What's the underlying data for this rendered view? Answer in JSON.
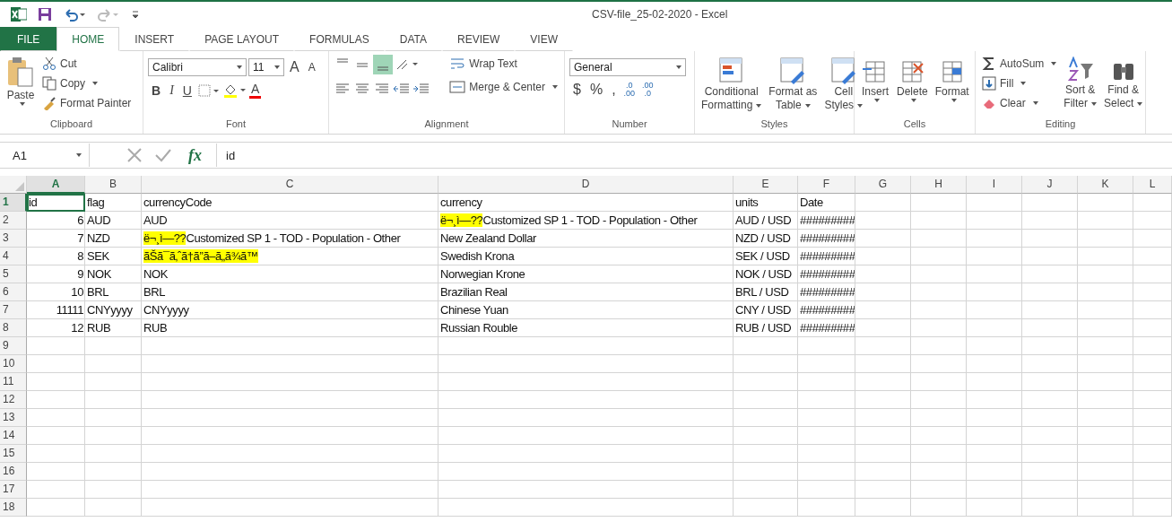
{
  "title": "CSV-file_25-02-2020 - Excel",
  "tabs": [
    {
      "label": "FILE",
      "kind": "file",
      "selected": false
    },
    {
      "label": "HOME",
      "kind": "tab",
      "selected": true
    },
    {
      "label": "INSERT",
      "kind": "tab",
      "selected": false
    },
    {
      "label": "PAGE LAYOUT",
      "kind": "tab",
      "selected": false
    },
    {
      "label": "FORMULAS",
      "kind": "tab",
      "selected": false
    },
    {
      "label": "DATA",
      "kind": "tab",
      "selected": false
    },
    {
      "label": "REVIEW",
      "kind": "tab",
      "selected": false
    },
    {
      "label": "VIEW",
      "kind": "tab",
      "selected": false
    }
  ],
  "ribbon": {
    "clipboard": {
      "label": "Clipboard",
      "paste": "Paste",
      "cut": "Cut",
      "copy": "Copy",
      "format_painter": "Format Painter"
    },
    "font": {
      "label": "Font",
      "font_name": "Calibri",
      "font_size": "11",
      "grow": "A",
      "shrink": "A",
      "bold": "B",
      "italic": "I",
      "underline": "U",
      "font_color": "A"
    },
    "alignment": {
      "label": "Alignment",
      "wrap_text": "Wrap Text",
      "merge_center": "Merge & Center",
      "bottom_align_selected": true
    },
    "number": {
      "label": "Number",
      "format": "General",
      "currency": "$",
      "percent": "%",
      "comma": ",",
      "decimals": [
        {
          "top": ".0",
          "bottom": ".00"
        },
        {
          "top": ".00",
          "bottom": ".0"
        }
      ]
    },
    "styles": {
      "label": "Styles",
      "buttons": [
        {
          "lines": [
            "Conditional",
            "Formatting"
          ]
        },
        {
          "lines": [
            "Format as",
            "Table"
          ]
        },
        {
          "lines": [
            "Cell",
            "Styles"
          ]
        }
      ]
    },
    "cells": {
      "label": "Cells",
      "buttons": [
        "Insert",
        "Delete",
        "Format"
      ]
    },
    "editing": {
      "label": "Editing",
      "autosum": "AutoSum",
      "fill": "Fill",
      "clear": "Clear",
      "buttons": [
        {
          "lines": [
            "Sort &",
            "Filter"
          ]
        },
        {
          "lines": [
            "Find &",
            "Select"
          ]
        }
      ]
    }
  },
  "formula_bar": {
    "name_box": "A1",
    "fx": "fx",
    "value": "id"
  },
  "columns": [
    {
      "label": "A",
      "selected": true
    },
    {
      "label": "B",
      "selected": false
    },
    {
      "label": "C",
      "selected": false
    },
    {
      "label": "D",
      "selected": false
    },
    {
      "label": "E",
      "selected": false
    },
    {
      "label": "F",
      "selected": false
    },
    {
      "label": "G",
      "selected": false
    },
    {
      "label": "H",
      "selected": false
    },
    {
      "label": "I",
      "selected": false
    },
    {
      "label": "J",
      "selected": false
    },
    {
      "label": "K",
      "selected": false
    },
    {
      "label": "L",
      "selected": false
    }
  ],
  "rows": [
    {
      "label": "1",
      "selected": true,
      "cells": [
        {
          "text": "id",
          "kind": "text"
        },
        {
          "text": "flag",
          "kind": "text"
        },
        {
          "text": "currencyCode",
          "kind": "text"
        },
        {
          "text": "currency",
          "kind": "text"
        },
        {
          "text": "units",
          "kind": "text"
        },
        {
          "text": "Date",
          "kind": "text"
        }
      ]
    },
    {
      "label": "2",
      "selected": false,
      "cells": [
        {
          "text": "6",
          "kind": "number"
        },
        {
          "text": "AUD",
          "kind": "text"
        },
        {
          "text": "AUD",
          "kind": "text"
        },
        {
          "highlight": "ë¬¸ì—??",
          "text": "Customized SP 1 - TOD - Population - Other",
          "kind": "text"
        },
        {
          "text": "AUD / USD",
          "kind": "text"
        },
        {
          "text": "#########",
          "kind": "text"
        }
      ]
    },
    {
      "label": "3",
      "selected": false,
      "cells": [
        {
          "text": "7",
          "kind": "number"
        },
        {
          "text": "NZD",
          "kind": "text"
        },
        {
          "highlight": "ë¬¸ì—??",
          "text": "Customized SP 1 - TOD - Population - Other",
          "kind": "text"
        },
        {
          "text": "New Zealand Dollar",
          "kind": "text"
        },
        {
          "text": "NZD / USD",
          "kind": "text"
        },
        {
          "text": "#########",
          "kind": "text"
        }
      ]
    },
    {
      "label": "4",
      "selected": false,
      "cells": [
        {
          "text": "8",
          "kind": "number"
        },
        {
          "text": "SEK",
          "kind": "text"
        },
        {
          "highlight": "ãŠã¯ã‚ˆã†ã”ã–ã„ã¾ã™",
          "kind": "text"
        },
        {
          "text": "Swedish Krona",
          "kind": "text"
        },
        {
          "text": "SEK / USD",
          "kind": "text"
        },
        {
          "text": "#########",
          "kind": "text"
        }
      ]
    },
    {
      "label": "5",
      "selected": false,
      "cells": [
        {
          "text": "9",
          "kind": "number"
        },
        {
          "text": "NOK",
          "kind": "text"
        },
        {
          "text": "NOK",
          "kind": "text"
        },
        {
          "text": "Norwegian Krone",
          "kind": "text"
        },
        {
          "text": "NOK / USD",
          "kind": "text"
        },
        {
          "text": "#########",
          "kind": "text"
        }
      ]
    },
    {
      "label": "6",
      "selected": false,
      "cells": [
        {
          "text": "10",
          "kind": "number"
        },
        {
          "text": "BRL",
          "kind": "text"
        },
        {
          "text": "BRL",
          "kind": "text"
        },
        {
          "text": "Brazilian Real",
          "kind": "text"
        },
        {
          "text": "BRL / USD",
          "kind": "text"
        },
        {
          "text": "#########",
          "kind": "text"
        }
      ]
    },
    {
      "label": "7",
      "selected": false,
      "cells": [
        {
          "text": "11111",
          "kind": "number"
        },
        {
          "text": "CNYyyyy",
          "kind": "text"
        },
        {
          "text": "CNYyyyy",
          "kind": "text"
        },
        {
          "text": "Chinese Yuan",
          "kind": "text"
        },
        {
          "text": "CNY / USD",
          "kind": "text"
        },
        {
          "text": "#########",
          "kind": "text"
        }
      ]
    },
    {
      "label": "8",
      "selected": false,
      "cells": [
        {
          "text": "12",
          "kind": "number"
        },
        {
          "text": "RUB",
          "kind": "text"
        },
        {
          "text": "RUB",
          "kind": "text"
        },
        {
          "text": "Russian Rouble",
          "kind": "text"
        },
        {
          "text": "RUB / USD",
          "kind": "text"
        },
        {
          "text": "#########",
          "kind": "text"
        }
      ]
    },
    {
      "label": "9",
      "selected": false
    },
    {
      "label": "10",
      "selected": false
    },
    {
      "label": "11",
      "selected": false
    },
    {
      "label": "12",
      "selected": false
    },
    {
      "label": "13",
      "selected": false
    },
    {
      "label": "14",
      "selected": false
    },
    {
      "label": "15",
      "selected": false
    },
    {
      "label": "16",
      "selected": false
    },
    {
      "label": "17",
      "selected": false
    },
    {
      "label": "18",
      "selected": false
    }
  ]
}
